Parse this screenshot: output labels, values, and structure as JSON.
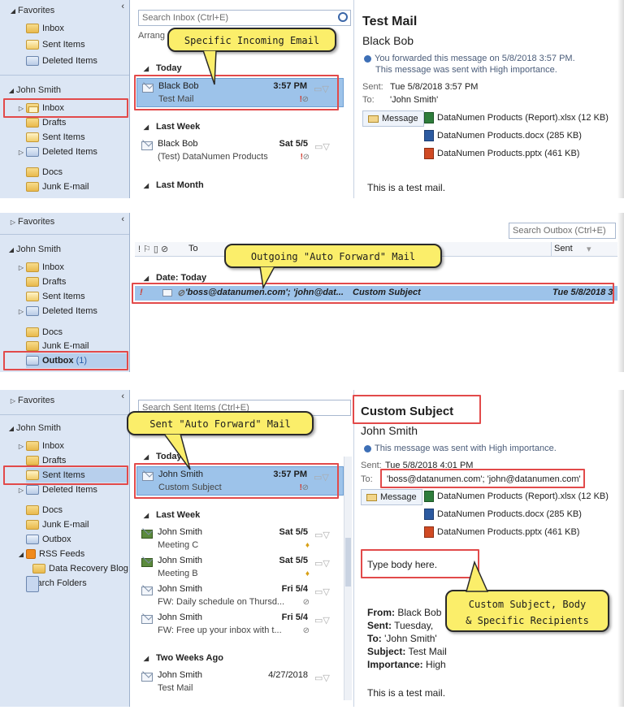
{
  "p1": {
    "nav": {
      "favorites": "Favorites",
      "fav_items": [
        "Inbox",
        "Sent Items",
        "Deleted Items"
      ],
      "account": "John Smith",
      "items": [
        "Inbox",
        "Drafts",
        "Sent Items",
        "Deleted Items",
        "Docs",
        "Junk E-mail"
      ]
    },
    "list": {
      "search_placeholder": "Search Inbox (Ctrl+E)",
      "arrange": "Arrang",
      "groups": [
        "Today",
        "Last Week",
        "Last Month"
      ],
      "rows": [
        {
          "from": "Black Bob",
          "subject": "Test Mail",
          "time": "3:57 PM"
        },
        {
          "from": "Black Bob",
          "subject": "(Test) DataNumen Products",
          "time": "Sat 5/5"
        }
      ]
    },
    "reading": {
      "title": "Test Mail",
      "from": "Black Bob",
      "info1": "You forwarded this message on 5/8/2018 3:57 PM.",
      "info2": "This message was sent with High importance.",
      "sent_label": "Sent:",
      "sent_value": "Tue 5/8/2018 3:57 PM",
      "to_label": "To:",
      "to_value": "'John Smith'",
      "message_btn": "Message",
      "attachments": [
        "DataNumen Products (Report).xlsx (12 KB)",
        "DataNumen Products.docx (285 KB)",
        "DataNumen Products.pptx (461 KB)"
      ],
      "body": "This is a test mail."
    },
    "callout": "Specific Incoming Email"
  },
  "p2": {
    "nav": {
      "favorites": "Favorites",
      "account": "John Smith",
      "items": [
        "Inbox",
        "Drafts",
        "Sent Items",
        "Deleted Items",
        "Docs",
        "Junk E-mail"
      ],
      "outbox": "Outbox",
      "outbox_count": "(1)"
    },
    "search_placeholder": "Search Outbox (Ctrl+E)",
    "col_to": "To",
    "col_sent": "Sent",
    "group": "Date: Today",
    "row": {
      "to": "'boss@datanumen.com'; 'john@dat...",
      "subject": "Custom Subject",
      "sent": "Tue 5/8/2018 3"
    },
    "callout": "Outgoing \"Auto Forward\" Mail"
  },
  "p3": {
    "nav": {
      "favorites": "Favorites",
      "account": "John Smith",
      "items": [
        "Inbox",
        "Drafts",
        "Sent Items",
        "Deleted Items",
        "Docs",
        "Junk E-mail",
        "Outbox",
        "RSS Feeds",
        "Data Recovery Blog",
        "Search Folders"
      ]
    },
    "list": {
      "search_placeholder": "Search Sent Items (Ctrl+E)",
      "groups": [
        "Today",
        "Last Week",
        "Two Weeks Ago"
      ],
      "rows": [
        {
          "from": "John Smith",
          "subject": "Custom Subject",
          "time": "3:57 PM"
        },
        {
          "from": "John Smith",
          "subject": "Meeting C",
          "time": "Sat 5/5"
        },
        {
          "from": "John Smith",
          "subject": "Meeting B",
          "time": "Sat 5/5"
        },
        {
          "from": "John Smith",
          "subject": "FW: Daily schedule on Thursd...",
          "time": "Fri 5/4"
        },
        {
          "from": "John Smith",
          "subject": "FW: Free up your inbox with t...",
          "time": "Fri 5/4"
        },
        {
          "from": "John Smith",
          "subject": "Test Mail",
          "time": "4/27/2018"
        }
      ]
    },
    "reading": {
      "title": "Custom Subject",
      "from": "John Smith",
      "info": "This message was sent with High importance.",
      "sent_label": "Sent:",
      "sent_value": "Tue 5/8/2018 4:01 PM",
      "to_label": "To:",
      "to_value": "'boss@datanumen.com'; 'john@datanumen.com'",
      "message_btn": "Message",
      "attachments": [
        "DataNumen Products (Report).xlsx (12 KB)",
        "DataNumen Products.docx (285 KB)",
        "DataNumen Products.pptx (461 KB)"
      ],
      "body": "Type body here.",
      "fw_from_label": "From:",
      "fw_from": "Black Bob",
      "fw_sent_label": "Sent:",
      "fw_sent": "Tuesday,",
      "fw_to_label": "To:",
      "fw_to": "'John Smith'",
      "fw_subject_label": "Subject:",
      "fw_subject": "Test Mail",
      "fw_importance_label": "Importance:",
      "fw_importance": "High",
      "fw_body": "This is a test mail."
    },
    "callout1": "Sent \"Auto Forward\" Mail",
    "callout2_line1": "Custom Subject, Body",
    "callout2_line2": "& Specific Recipients"
  },
  "colors": {
    "nav_bg": "#dce6f4",
    "selected": "#9dc3ea",
    "callout": "#fbee6a",
    "highlight_border": "#e24a4a"
  }
}
